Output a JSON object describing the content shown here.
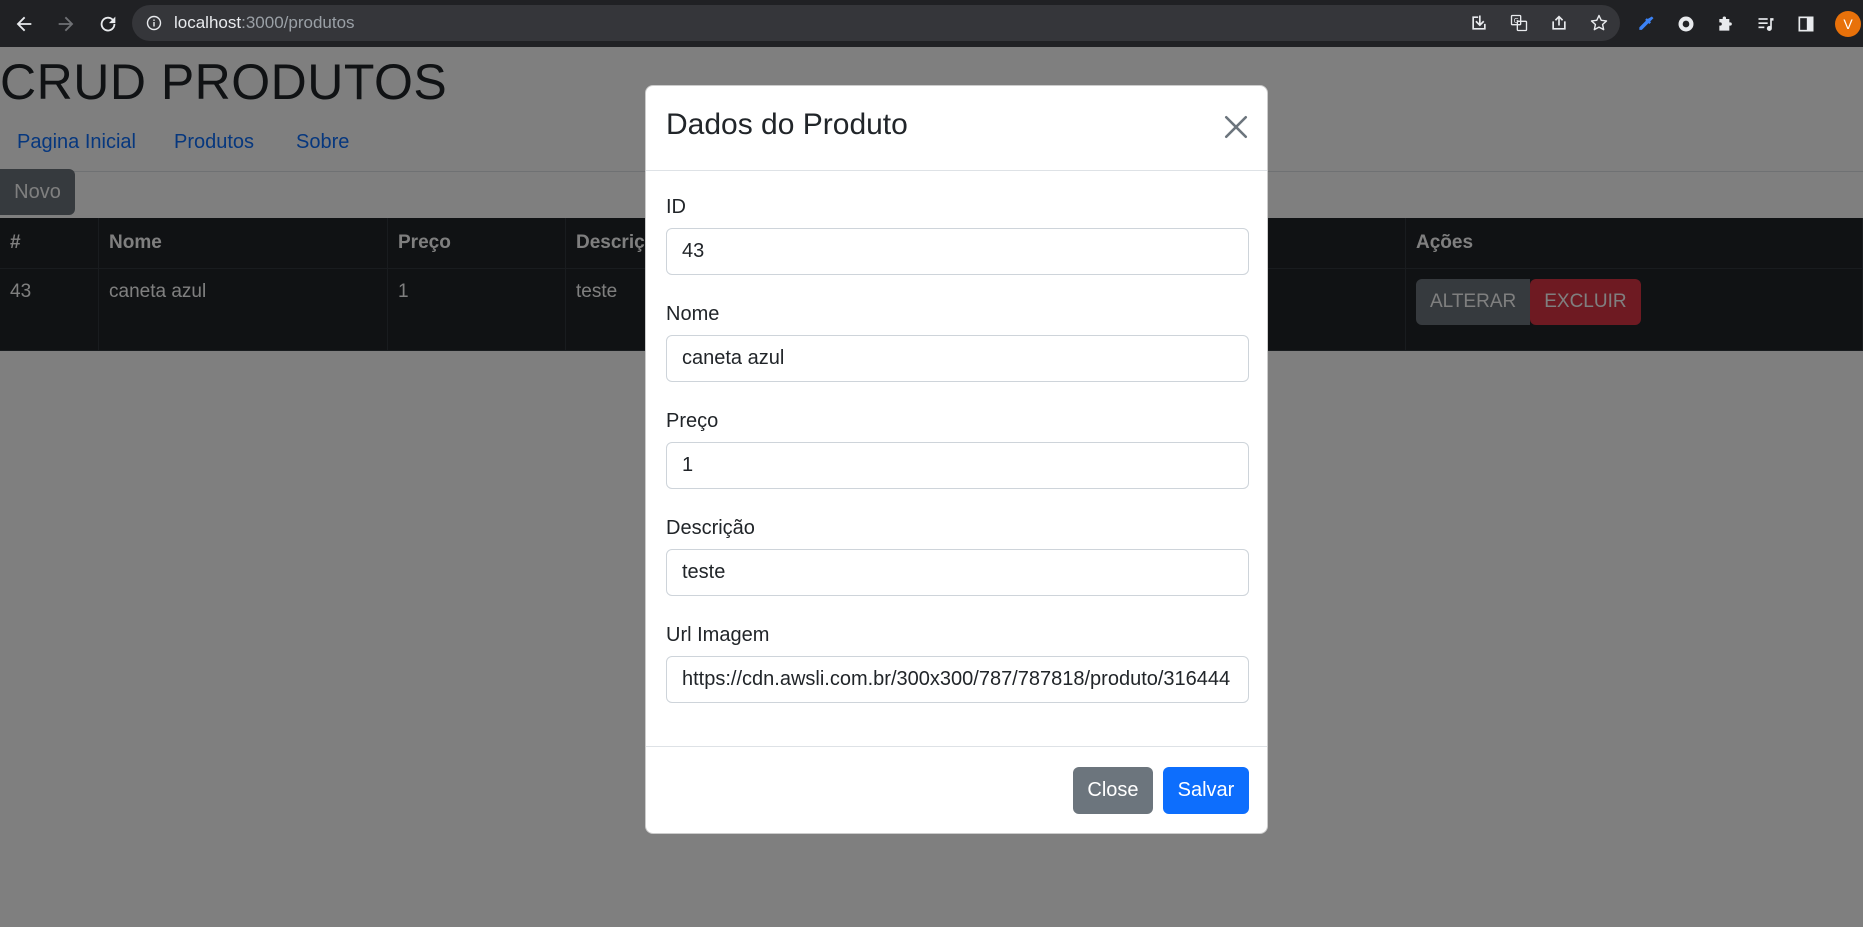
{
  "browser": {
    "url_host": "localhost",
    "url_path": ":3000/produtos",
    "profile_initial": "V"
  },
  "page": {
    "title": "CRUD PRODUTOS",
    "nav": [
      "Pagina Inicial",
      "Produtos",
      "Sobre"
    ],
    "new_button": "Novo",
    "table": {
      "headers": [
        "#",
        "Nome",
        "Preço",
        "Descriç",
        "Ações"
      ],
      "rows": [
        {
          "id": "43",
          "nome": "caneta azul",
          "preco": "1",
          "descricao": "teste"
        }
      ],
      "edit_label": "ALTERAR",
      "delete_label": "EXCLUIR"
    }
  },
  "modal": {
    "title": "Dados do Produto",
    "fields": [
      {
        "label": "ID",
        "value": "43"
      },
      {
        "label": "Nome",
        "value": "caneta azul"
      },
      {
        "label": "Preço",
        "value": "1"
      },
      {
        "label": "Descrição",
        "value": "teste"
      },
      {
        "label": "Url Imagem",
        "value": "https://cdn.awsli.com.br/300x300/787/787818/produto/316444"
      }
    ],
    "close_label": "Close",
    "save_label": "Salvar"
  }
}
